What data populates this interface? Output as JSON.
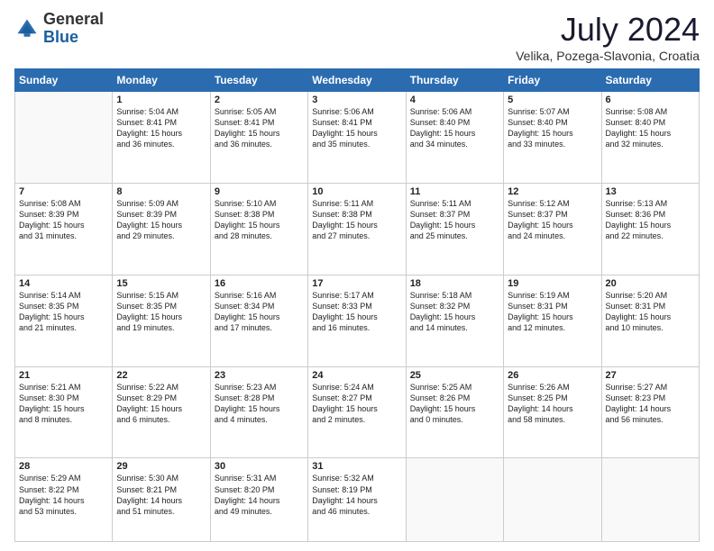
{
  "header": {
    "logo_general": "General",
    "logo_blue": "Blue",
    "title": "July 2024",
    "subtitle": "Velika, Pozega-Slavonia, Croatia"
  },
  "days_of_week": [
    "Sunday",
    "Monday",
    "Tuesday",
    "Wednesday",
    "Thursday",
    "Friday",
    "Saturday"
  ],
  "weeks": [
    [
      {
        "day": "",
        "content": ""
      },
      {
        "day": "1",
        "content": "Sunrise: 5:04 AM\nSunset: 8:41 PM\nDaylight: 15 hours\nand 36 minutes."
      },
      {
        "day": "2",
        "content": "Sunrise: 5:05 AM\nSunset: 8:41 PM\nDaylight: 15 hours\nand 36 minutes."
      },
      {
        "day": "3",
        "content": "Sunrise: 5:06 AM\nSunset: 8:41 PM\nDaylight: 15 hours\nand 35 minutes."
      },
      {
        "day": "4",
        "content": "Sunrise: 5:06 AM\nSunset: 8:40 PM\nDaylight: 15 hours\nand 34 minutes."
      },
      {
        "day": "5",
        "content": "Sunrise: 5:07 AM\nSunset: 8:40 PM\nDaylight: 15 hours\nand 33 minutes."
      },
      {
        "day": "6",
        "content": "Sunrise: 5:08 AM\nSunset: 8:40 PM\nDaylight: 15 hours\nand 32 minutes."
      }
    ],
    [
      {
        "day": "7",
        "content": "Sunrise: 5:08 AM\nSunset: 8:39 PM\nDaylight: 15 hours\nand 31 minutes."
      },
      {
        "day": "8",
        "content": "Sunrise: 5:09 AM\nSunset: 8:39 PM\nDaylight: 15 hours\nand 29 minutes."
      },
      {
        "day": "9",
        "content": "Sunrise: 5:10 AM\nSunset: 8:38 PM\nDaylight: 15 hours\nand 28 minutes."
      },
      {
        "day": "10",
        "content": "Sunrise: 5:11 AM\nSunset: 8:38 PM\nDaylight: 15 hours\nand 27 minutes."
      },
      {
        "day": "11",
        "content": "Sunrise: 5:11 AM\nSunset: 8:37 PM\nDaylight: 15 hours\nand 25 minutes."
      },
      {
        "day": "12",
        "content": "Sunrise: 5:12 AM\nSunset: 8:37 PM\nDaylight: 15 hours\nand 24 minutes."
      },
      {
        "day": "13",
        "content": "Sunrise: 5:13 AM\nSunset: 8:36 PM\nDaylight: 15 hours\nand 22 minutes."
      }
    ],
    [
      {
        "day": "14",
        "content": "Sunrise: 5:14 AM\nSunset: 8:35 PM\nDaylight: 15 hours\nand 21 minutes."
      },
      {
        "day": "15",
        "content": "Sunrise: 5:15 AM\nSunset: 8:35 PM\nDaylight: 15 hours\nand 19 minutes."
      },
      {
        "day": "16",
        "content": "Sunrise: 5:16 AM\nSunset: 8:34 PM\nDaylight: 15 hours\nand 17 minutes."
      },
      {
        "day": "17",
        "content": "Sunrise: 5:17 AM\nSunset: 8:33 PM\nDaylight: 15 hours\nand 16 minutes."
      },
      {
        "day": "18",
        "content": "Sunrise: 5:18 AM\nSunset: 8:32 PM\nDaylight: 15 hours\nand 14 minutes."
      },
      {
        "day": "19",
        "content": "Sunrise: 5:19 AM\nSunset: 8:31 PM\nDaylight: 15 hours\nand 12 minutes."
      },
      {
        "day": "20",
        "content": "Sunrise: 5:20 AM\nSunset: 8:31 PM\nDaylight: 15 hours\nand 10 minutes."
      }
    ],
    [
      {
        "day": "21",
        "content": "Sunrise: 5:21 AM\nSunset: 8:30 PM\nDaylight: 15 hours\nand 8 minutes."
      },
      {
        "day": "22",
        "content": "Sunrise: 5:22 AM\nSunset: 8:29 PM\nDaylight: 15 hours\nand 6 minutes."
      },
      {
        "day": "23",
        "content": "Sunrise: 5:23 AM\nSunset: 8:28 PM\nDaylight: 15 hours\nand 4 minutes."
      },
      {
        "day": "24",
        "content": "Sunrise: 5:24 AM\nSunset: 8:27 PM\nDaylight: 15 hours\nand 2 minutes."
      },
      {
        "day": "25",
        "content": "Sunrise: 5:25 AM\nSunset: 8:26 PM\nDaylight: 15 hours\nand 0 minutes."
      },
      {
        "day": "26",
        "content": "Sunrise: 5:26 AM\nSunset: 8:25 PM\nDaylight: 14 hours\nand 58 minutes."
      },
      {
        "day": "27",
        "content": "Sunrise: 5:27 AM\nSunset: 8:23 PM\nDaylight: 14 hours\nand 56 minutes."
      }
    ],
    [
      {
        "day": "28",
        "content": "Sunrise: 5:29 AM\nSunset: 8:22 PM\nDaylight: 14 hours\nand 53 minutes."
      },
      {
        "day": "29",
        "content": "Sunrise: 5:30 AM\nSunset: 8:21 PM\nDaylight: 14 hours\nand 51 minutes."
      },
      {
        "day": "30",
        "content": "Sunrise: 5:31 AM\nSunset: 8:20 PM\nDaylight: 14 hours\nand 49 minutes."
      },
      {
        "day": "31",
        "content": "Sunrise: 5:32 AM\nSunset: 8:19 PM\nDaylight: 14 hours\nand 46 minutes."
      },
      {
        "day": "",
        "content": ""
      },
      {
        "day": "",
        "content": ""
      },
      {
        "day": "",
        "content": ""
      }
    ]
  ]
}
